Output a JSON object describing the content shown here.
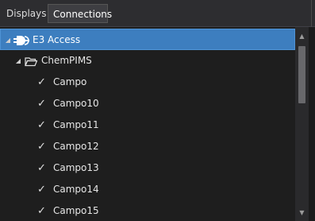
{
  "tabs": {
    "displays": "Displays",
    "connections": "Connections"
  },
  "tree": {
    "root": {
      "label": "E3 Access",
      "icon": "plug-connector-icon",
      "expanded": true,
      "selected": true
    },
    "folder": {
      "label": "ChemPIMS",
      "icon": "folder-open-icon",
      "expanded": true
    },
    "items": [
      {
        "label": "Campo",
        "icon": "checkmark-icon"
      },
      {
        "label": "Campo10",
        "icon": "checkmark-icon"
      },
      {
        "label": "Campo11",
        "icon": "checkmark-icon"
      },
      {
        "label": "Campo12",
        "icon": "checkmark-icon"
      },
      {
        "label": "Campo13",
        "icon": "checkmark-icon"
      },
      {
        "label": "Campo14",
        "icon": "checkmark-icon"
      },
      {
        "label": "Campo15",
        "icon": "checkmark-icon"
      }
    ]
  },
  "scrollbar": {
    "up_icon": "scroll-up-arrow-icon",
    "down_icon": "scroll-down-arrow-icon"
  },
  "colors": {
    "selection": "#3d7ebf",
    "background": "#1e1e1e",
    "tab_active": "#3e3e42"
  }
}
